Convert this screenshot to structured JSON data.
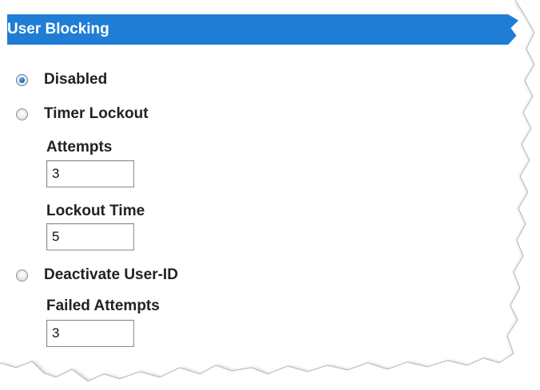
{
  "section": {
    "title": "User Blocking",
    "header_color": "#1f7dd6"
  },
  "options": [
    {
      "label": "Disabled",
      "checked": true
    },
    {
      "label": "Timer Lockout",
      "checked": false
    },
    {
      "label": "Deactivate User-ID",
      "checked": false
    }
  ],
  "timer_lockout": {
    "attempts_label": "Attempts",
    "attempts_value": "3",
    "lockout_time_label": "Lockout Time",
    "lockout_time_value": "5"
  },
  "deactivate": {
    "failed_attempts_label": "Failed Attempts",
    "failed_attempts_value": "3"
  }
}
